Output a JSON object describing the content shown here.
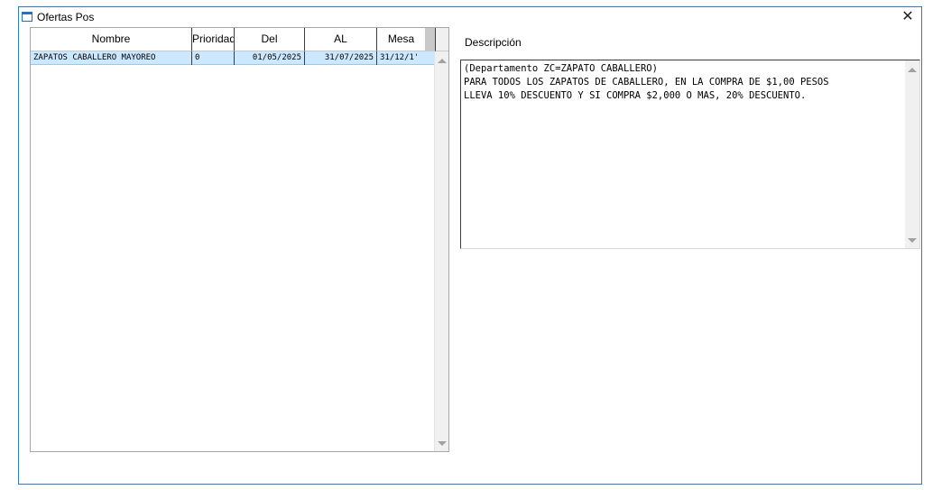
{
  "window": {
    "title": "Ofertas Pos",
    "close_icon": "close-icon"
  },
  "grid": {
    "columns": [
      "Nombre",
      "Prioridad",
      "Del",
      "AL",
      "Mesa"
    ],
    "rows": [
      {
        "nombre": "ZAPATOS CABALLERO MAYOREO",
        "prioridad": "0",
        "del": "01/05/2025",
        "al": "31/07/2025",
        "mesa": "31/12/1'"
      }
    ],
    "selected_row_color": "#cce8ff"
  },
  "description": {
    "label": "Descripción",
    "text": "(Departamento ZC=ZAPATO CABALLERO)\nPARA TODOS LOS ZAPATOS DE CABALLERO, EN LA COMPRA DE $1,00 PESOS\nLLEVA 10% DESCUENTO Y SI COMPRA $2,000 O MAS, 20% DESCUENTO."
  },
  "colors": {
    "window_border": "#2b79d0",
    "scrollbar": "#f0f0f0"
  }
}
